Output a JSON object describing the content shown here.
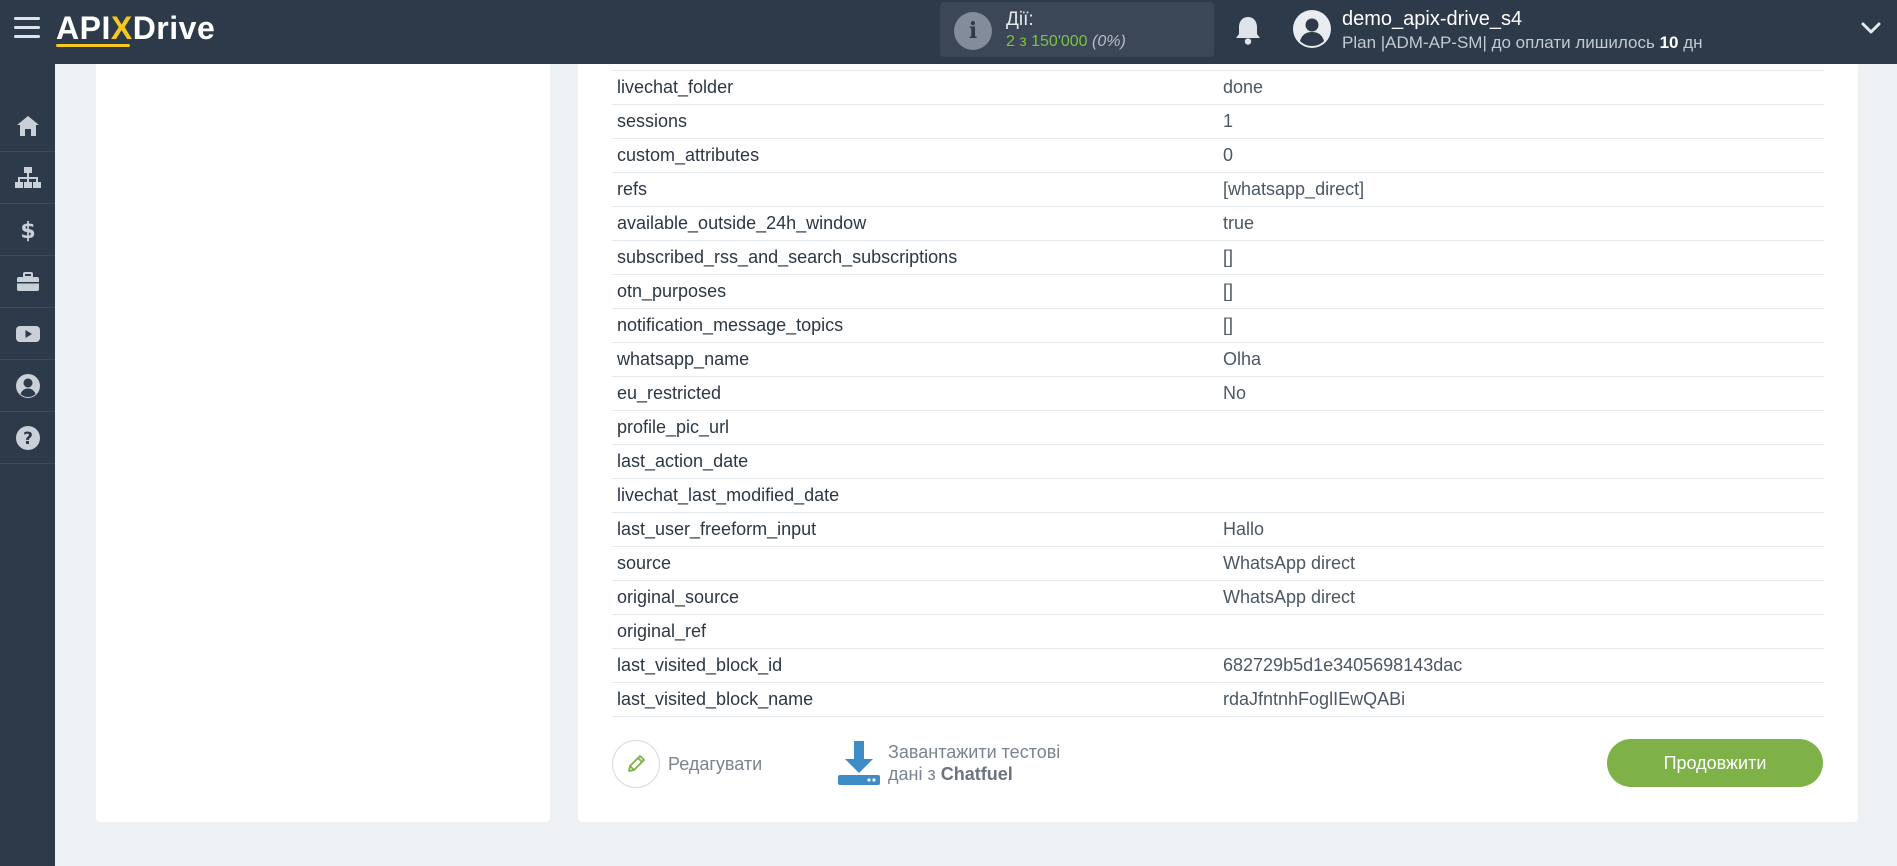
{
  "header": {
    "logo": {
      "part1": "API",
      "part2": "X",
      "part3": "Drive"
    },
    "actions": {
      "label": "Дії:",
      "count": "2 з 150'000",
      "percent": "(0%)"
    },
    "user": {
      "name": "demo_apix-drive_s4",
      "plan_prefix": "Plan |ADM-AP-SM| до оплати лишилось",
      "days_number": "10",
      "days_unit": "дн"
    }
  },
  "sidebar": {
    "items": [
      {
        "icon": "home-icon"
      },
      {
        "icon": "sitemap-icon"
      },
      {
        "icon": "dollar-icon"
      },
      {
        "icon": "briefcase-icon"
      },
      {
        "icon": "youtube-icon"
      },
      {
        "icon": "user-circle-icon"
      },
      {
        "icon": "help-icon"
      }
    ]
  },
  "fields": [
    {
      "key": "livechat_folder",
      "value": "done"
    },
    {
      "key": "sessions",
      "value": "1"
    },
    {
      "key": "custom_attributes",
      "value": "0"
    },
    {
      "key": "refs",
      "value": "[whatsapp_direct]"
    },
    {
      "key": "available_outside_24h_window",
      "value": "true"
    },
    {
      "key": "subscribed_rss_and_search_subscriptions",
      "value": "[]"
    },
    {
      "key": "otn_purposes",
      "value": "[]"
    },
    {
      "key": "notification_message_topics",
      "value": "[]"
    },
    {
      "key": "whatsapp_name",
      "value": "Olha"
    },
    {
      "key": "eu_restricted",
      "value": "No"
    },
    {
      "key": "profile_pic_url",
      "value": ""
    },
    {
      "key": "last_action_date",
      "value": ""
    },
    {
      "key": "livechat_last_modified_date",
      "value": ""
    },
    {
      "key": "last_user_freeform_input",
      "value": "Hallo"
    },
    {
      "key": "source",
      "value": "WhatsApp direct"
    },
    {
      "key": "original_source",
      "value": "WhatsApp direct"
    },
    {
      "key": "original_ref",
      "value": ""
    },
    {
      "key": "last_visited_block_id",
      "value": "682729b5d1e3405698143dac"
    },
    {
      "key": "last_visited_block_name",
      "value": "rdaJfntnhFoglIEwQABi"
    }
  ],
  "buttons": {
    "edit": "Редагувати",
    "download_line1": "Завантажити тестові",
    "download_line2_prefix": "дані з",
    "download_service": "Chatfuel",
    "continue": "Продовжити"
  },
  "colors": {
    "topbar": "#2d3a49",
    "accent_yellow": "#f7c81e",
    "accent_green": "#7eb249",
    "page_bg": "#eef1f4"
  }
}
